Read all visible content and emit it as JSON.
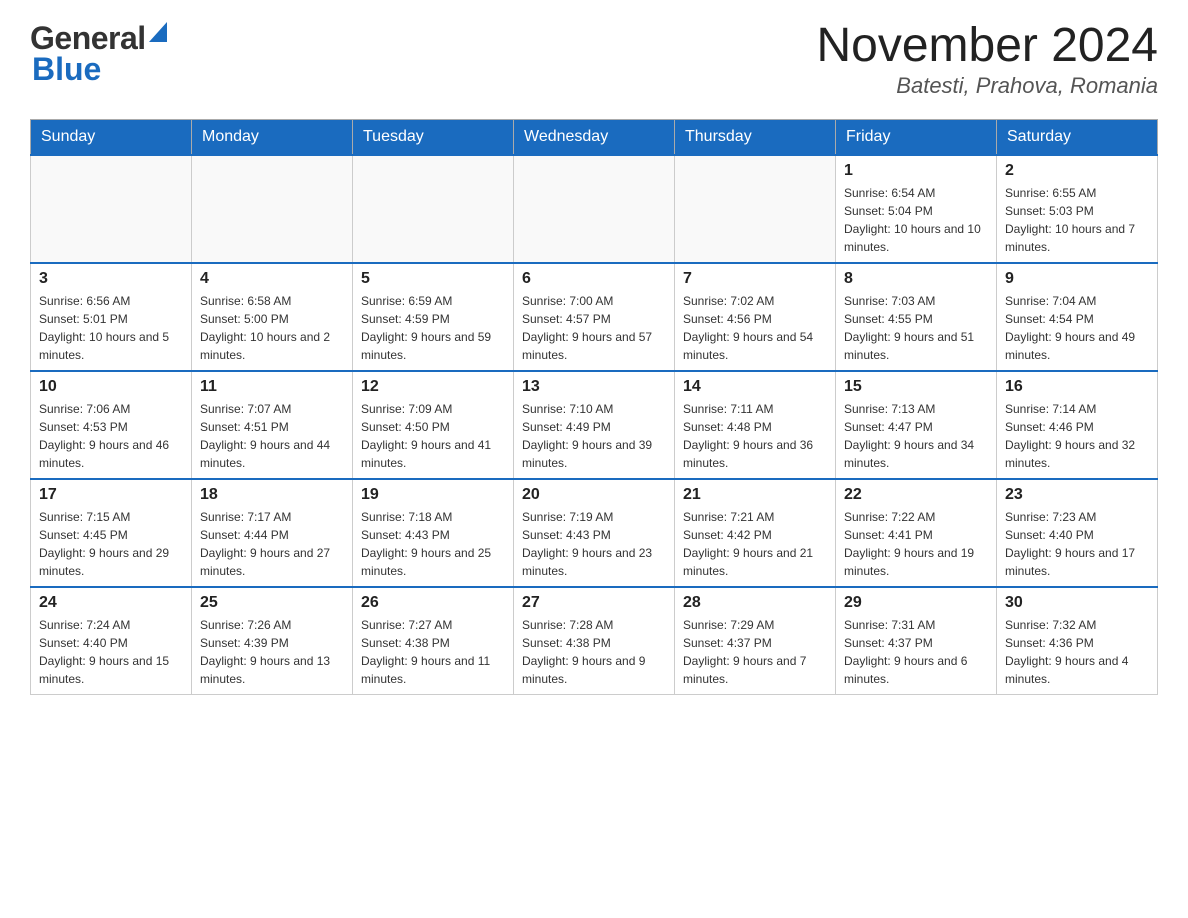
{
  "header": {
    "logo": {
      "line1": "General",
      "line2": "Blue"
    },
    "title": "November 2024",
    "location": "Batesti, Prahova, Romania"
  },
  "weekdays": [
    "Sunday",
    "Monday",
    "Tuesday",
    "Wednesday",
    "Thursday",
    "Friday",
    "Saturday"
  ],
  "weeks": [
    [
      {
        "day": "",
        "sunrise": "",
        "sunset": "",
        "daylight": ""
      },
      {
        "day": "",
        "sunrise": "",
        "sunset": "",
        "daylight": ""
      },
      {
        "day": "",
        "sunrise": "",
        "sunset": "",
        "daylight": ""
      },
      {
        "day": "",
        "sunrise": "",
        "sunset": "",
        "daylight": ""
      },
      {
        "day": "",
        "sunrise": "",
        "sunset": "",
        "daylight": ""
      },
      {
        "day": "1",
        "sunrise": "Sunrise: 6:54 AM",
        "sunset": "Sunset: 5:04 PM",
        "daylight": "Daylight: 10 hours and 10 minutes."
      },
      {
        "day": "2",
        "sunrise": "Sunrise: 6:55 AM",
        "sunset": "Sunset: 5:03 PM",
        "daylight": "Daylight: 10 hours and 7 minutes."
      }
    ],
    [
      {
        "day": "3",
        "sunrise": "Sunrise: 6:56 AM",
        "sunset": "Sunset: 5:01 PM",
        "daylight": "Daylight: 10 hours and 5 minutes."
      },
      {
        "day": "4",
        "sunrise": "Sunrise: 6:58 AM",
        "sunset": "Sunset: 5:00 PM",
        "daylight": "Daylight: 10 hours and 2 minutes."
      },
      {
        "day": "5",
        "sunrise": "Sunrise: 6:59 AM",
        "sunset": "Sunset: 4:59 PM",
        "daylight": "Daylight: 9 hours and 59 minutes."
      },
      {
        "day": "6",
        "sunrise": "Sunrise: 7:00 AM",
        "sunset": "Sunset: 4:57 PM",
        "daylight": "Daylight: 9 hours and 57 minutes."
      },
      {
        "day": "7",
        "sunrise": "Sunrise: 7:02 AM",
        "sunset": "Sunset: 4:56 PM",
        "daylight": "Daylight: 9 hours and 54 minutes."
      },
      {
        "day": "8",
        "sunrise": "Sunrise: 7:03 AM",
        "sunset": "Sunset: 4:55 PM",
        "daylight": "Daylight: 9 hours and 51 minutes."
      },
      {
        "day": "9",
        "sunrise": "Sunrise: 7:04 AM",
        "sunset": "Sunset: 4:54 PM",
        "daylight": "Daylight: 9 hours and 49 minutes."
      }
    ],
    [
      {
        "day": "10",
        "sunrise": "Sunrise: 7:06 AM",
        "sunset": "Sunset: 4:53 PM",
        "daylight": "Daylight: 9 hours and 46 minutes."
      },
      {
        "day": "11",
        "sunrise": "Sunrise: 7:07 AM",
        "sunset": "Sunset: 4:51 PM",
        "daylight": "Daylight: 9 hours and 44 minutes."
      },
      {
        "day": "12",
        "sunrise": "Sunrise: 7:09 AM",
        "sunset": "Sunset: 4:50 PM",
        "daylight": "Daylight: 9 hours and 41 minutes."
      },
      {
        "day": "13",
        "sunrise": "Sunrise: 7:10 AM",
        "sunset": "Sunset: 4:49 PM",
        "daylight": "Daylight: 9 hours and 39 minutes."
      },
      {
        "day": "14",
        "sunrise": "Sunrise: 7:11 AM",
        "sunset": "Sunset: 4:48 PM",
        "daylight": "Daylight: 9 hours and 36 minutes."
      },
      {
        "day": "15",
        "sunrise": "Sunrise: 7:13 AM",
        "sunset": "Sunset: 4:47 PM",
        "daylight": "Daylight: 9 hours and 34 minutes."
      },
      {
        "day": "16",
        "sunrise": "Sunrise: 7:14 AM",
        "sunset": "Sunset: 4:46 PM",
        "daylight": "Daylight: 9 hours and 32 minutes."
      }
    ],
    [
      {
        "day": "17",
        "sunrise": "Sunrise: 7:15 AM",
        "sunset": "Sunset: 4:45 PM",
        "daylight": "Daylight: 9 hours and 29 minutes."
      },
      {
        "day": "18",
        "sunrise": "Sunrise: 7:17 AM",
        "sunset": "Sunset: 4:44 PM",
        "daylight": "Daylight: 9 hours and 27 minutes."
      },
      {
        "day": "19",
        "sunrise": "Sunrise: 7:18 AM",
        "sunset": "Sunset: 4:43 PM",
        "daylight": "Daylight: 9 hours and 25 minutes."
      },
      {
        "day": "20",
        "sunrise": "Sunrise: 7:19 AM",
        "sunset": "Sunset: 4:43 PM",
        "daylight": "Daylight: 9 hours and 23 minutes."
      },
      {
        "day": "21",
        "sunrise": "Sunrise: 7:21 AM",
        "sunset": "Sunset: 4:42 PM",
        "daylight": "Daylight: 9 hours and 21 minutes."
      },
      {
        "day": "22",
        "sunrise": "Sunrise: 7:22 AM",
        "sunset": "Sunset: 4:41 PM",
        "daylight": "Daylight: 9 hours and 19 minutes."
      },
      {
        "day": "23",
        "sunrise": "Sunrise: 7:23 AM",
        "sunset": "Sunset: 4:40 PM",
        "daylight": "Daylight: 9 hours and 17 minutes."
      }
    ],
    [
      {
        "day": "24",
        "sunrise": "Sunrise: 7:24 AM",
        "sunset": "Sunset: 4:40 PM",
        "daylight": "Daylight: 9 hours and 15 minutes."
      },
      {
        "day": "25",
        "sunrise": "Sunrise: 7:26 AM",
        "sunset": "Sunset: 4:39 PM",
        "daylight": "Daylight: 9 hours and 13 minutes."
      },
      {
        "day": "26",
        "sunrise": "Sunrise: 7:27 AM",
        "sunset": "Sunset: 4:38 PM",
        "daylight": "Daylight: 9 hours and 11 minutes."
      },
      {
        "day": "27",
        "sunrise": "Sunrise: 7:28 AM",
        "sunset": "Sunset: 4:38 PM",
        "daylight": "Daylight: 9 hours and 9 minutes."
      },
      {
        "day": "28",
        "sunrise": "Sunrise: 7:29 AM",
        "sunset": "Sunset: 4:37 PM",
        "daylight": "Daylight: 9 hours and 7 minutes."
      },
      {
        "day": "29",
        "sunrise": "Sunrise: 7:31 AM",
        "sunset": "Sunset: 4:37 PM",
        "daylight": "Daylight: 9 hours and 6 minutes."
      },
      {
        "day": "30",
        "sunrise": "Sunrise: 7:32 AM",
        "sunset": "Sunset: 4:36 PM",
        "daylight": "Daylight: 9 hours and 4 minutes."
      }
    ]
  ]
}
